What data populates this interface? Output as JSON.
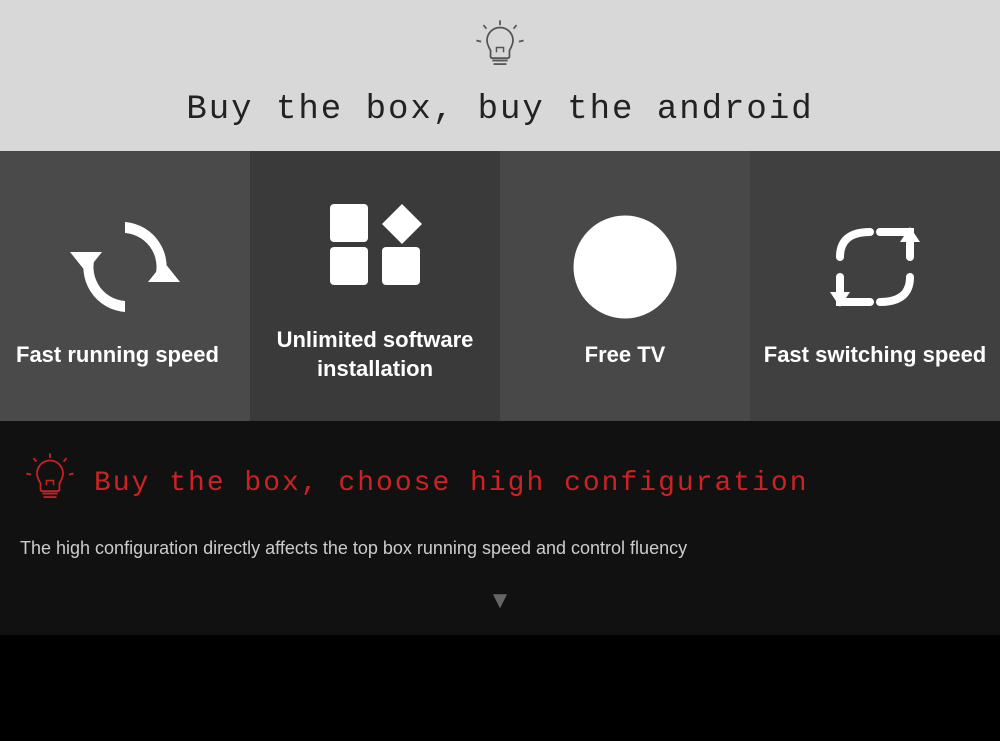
{
  "top": {
    "tagline": "Buy the box, buy the android"
  },
  "features": [
    {
      "id": "fast-running",
      "icon": "sync",
      "label": "Fast running speed"
    },
    {
      "id": "unlimited-software",
      "icon": "apps",
      "label": "Unlimited software installation"
    },
    {
      "id": "free-tv",
      "icon": "no-yen",
      "label": "Free TV"
    },
    {
      "id": "fast-switching",
      "icon": "switch",
      "label": "Fast switching speed"
    }
  ],
  "bottom": {
    "tagline": "Buy the box, choose high configuration",
    "description": "The high configuration directly affects the top box running speed and control fluency"
  }
}
